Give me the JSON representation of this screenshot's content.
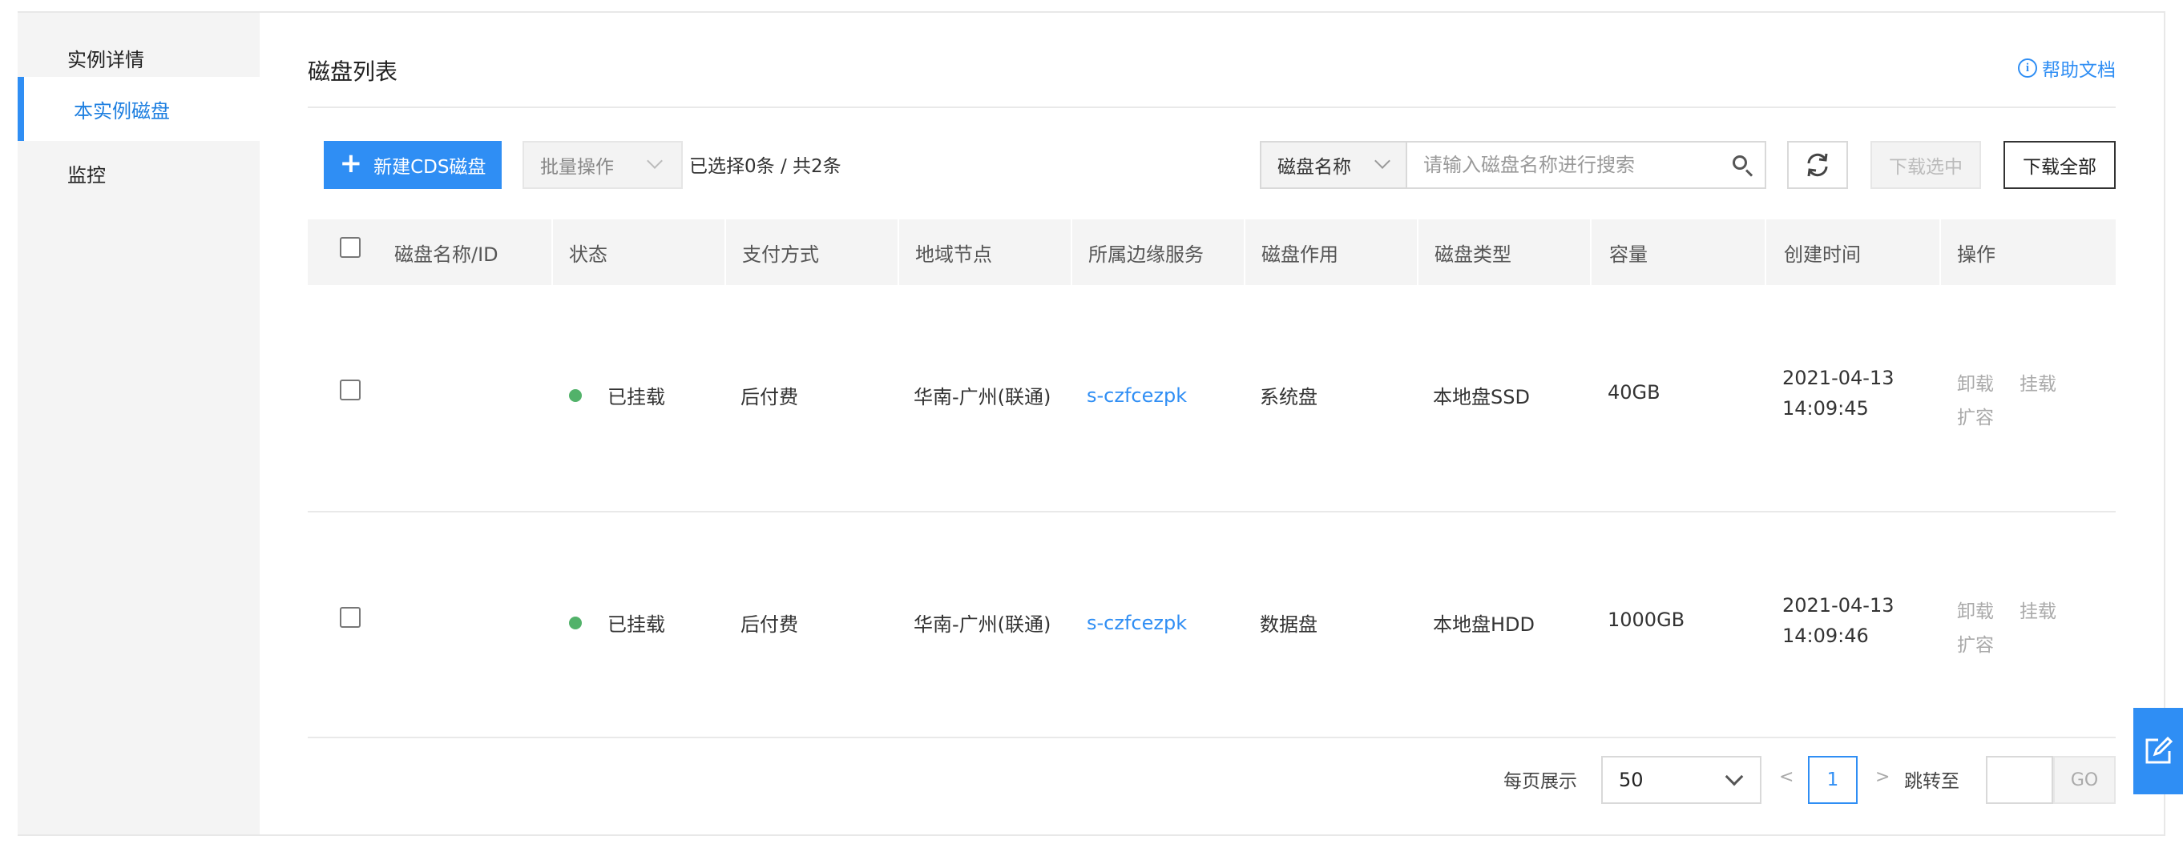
{
  "sidebar": {
    "items": [
      {
        "label": "实例详情",
        "active": false
      },
      {
        "label": "本实例磁盘",
        "active": true
      },
      {
        "label": "监控",
        "active": false
      }
    ]
  },
  "header": {
    "title": "磁盘列表",
    "help_link": "帮助文档",
    "help_icon": "info-circle-icon"
  },
  "toolbar": {
    "new_button": "新建CDS磁盘",
    "batch_select": "批量操作",
    "selection_count": "已选择0条 / 共2条",
    "search_field": "磁盘名称",
    "search_placeholder": "请输入磁盘名称进行搜索",
    "download_selected": "下载选中",
    "download_all": "下载全部"
  },
  "table": {
    "columns": [
      "磁盘名称/ID",
      "状态",
      "支付方式",
      "地域节点",
      "所属边缘服务",
      "磁盘作用",
      "磁盘类型",
      "容量",
      "创建时间",
      "操作"
    ],
    "rows": [
      {
        "name_id": "",
        "status": "已挂载",
        "payment": "后付费",
        "region": "华南-广州(联通)",
        "service": "s-czfcezpk",
        "role": "系统盘",
        "disk_type": "本地盘SSD",
        "capacity": "40GB",
        "created_date": "2021-04-13",
        "created_time": "14:09:45",
        "actions": [
          "卸载",
          "挂载",
          "扩容"
        ]
      },
      {
        "name_id": "",
        "status": "已挂载",
        "payment": "后付费",
        "region": "华南-广州(联通)",
        "service": "s-czfcezpk",
        "role": "数据盘",
        "disk_type": "本地盘HDD",
        "capacity": "1000GB",
        "created_date": "2021-04-13",
        "created_time": "14:09:46",
        "actions": [
          "卸载",
          "挂载",
          "扩容"
        ]
      }
    ]
  },
  "pagination": {
    "per_page_label": "每页展示",
    "per_page_value": "50",
    "prev": "<",
    "current_page": "1",
    "next": ">",
    "jump_label": "跳转至",
    "go_button": "GO"
  },
  "colors": {
    "accent": "#2f8ef4",
    "status_ok": "#52b26a"
  }
}
